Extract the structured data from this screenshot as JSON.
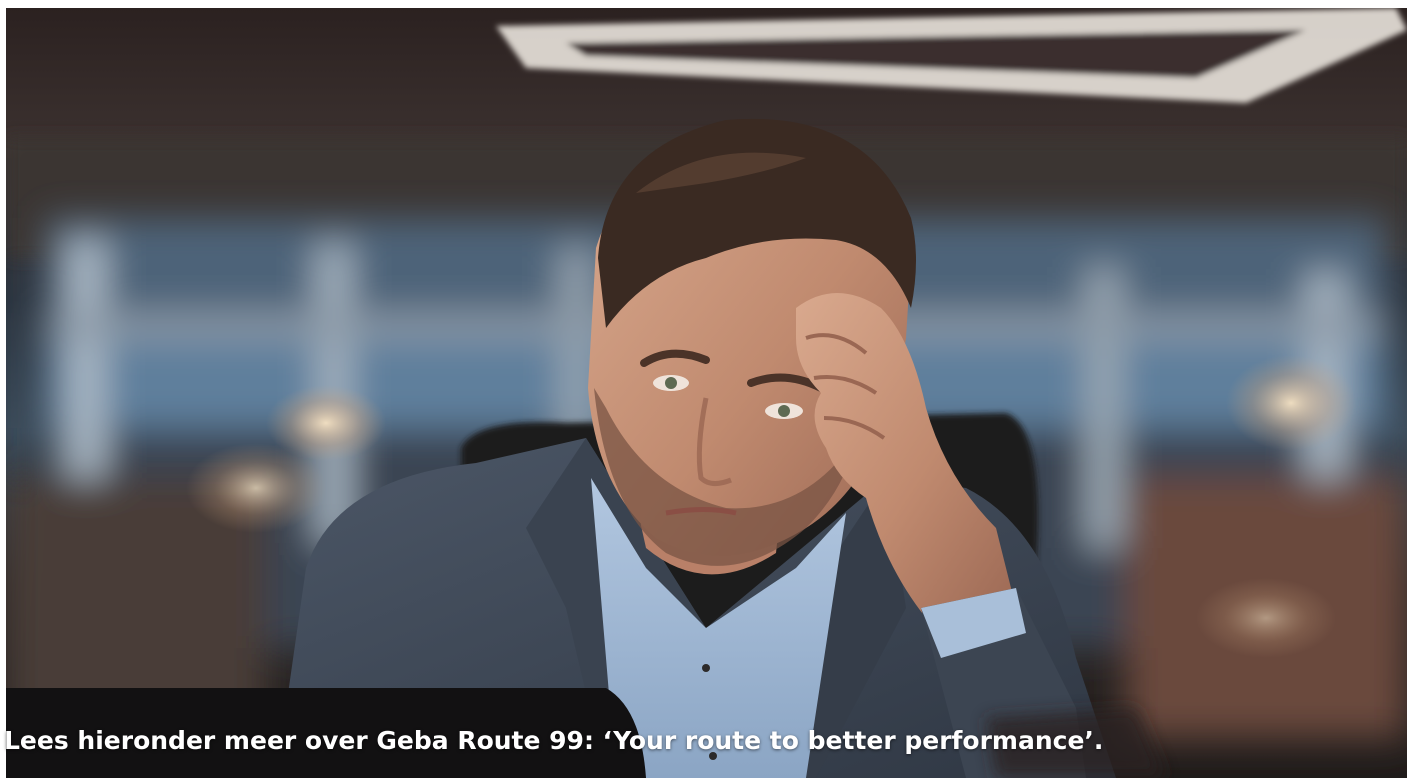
{
  "hero": {
    "caption": "Lees hieronder meer over Geba Route 99: ‘Your route to better performance’.",
    "photo": {
      "icon": "photo-of-stressed-businessman",
      "accent_colors": {
        "suit": "#3f4957",
        "shirt": "#9fb8d6",
        "skin": "#c9957a",
        "hair": "#3a2a22",
        "background_warm": "#6b4a3e",
        "background_cool": "#5d7a94"
      }
    }
  }
}
